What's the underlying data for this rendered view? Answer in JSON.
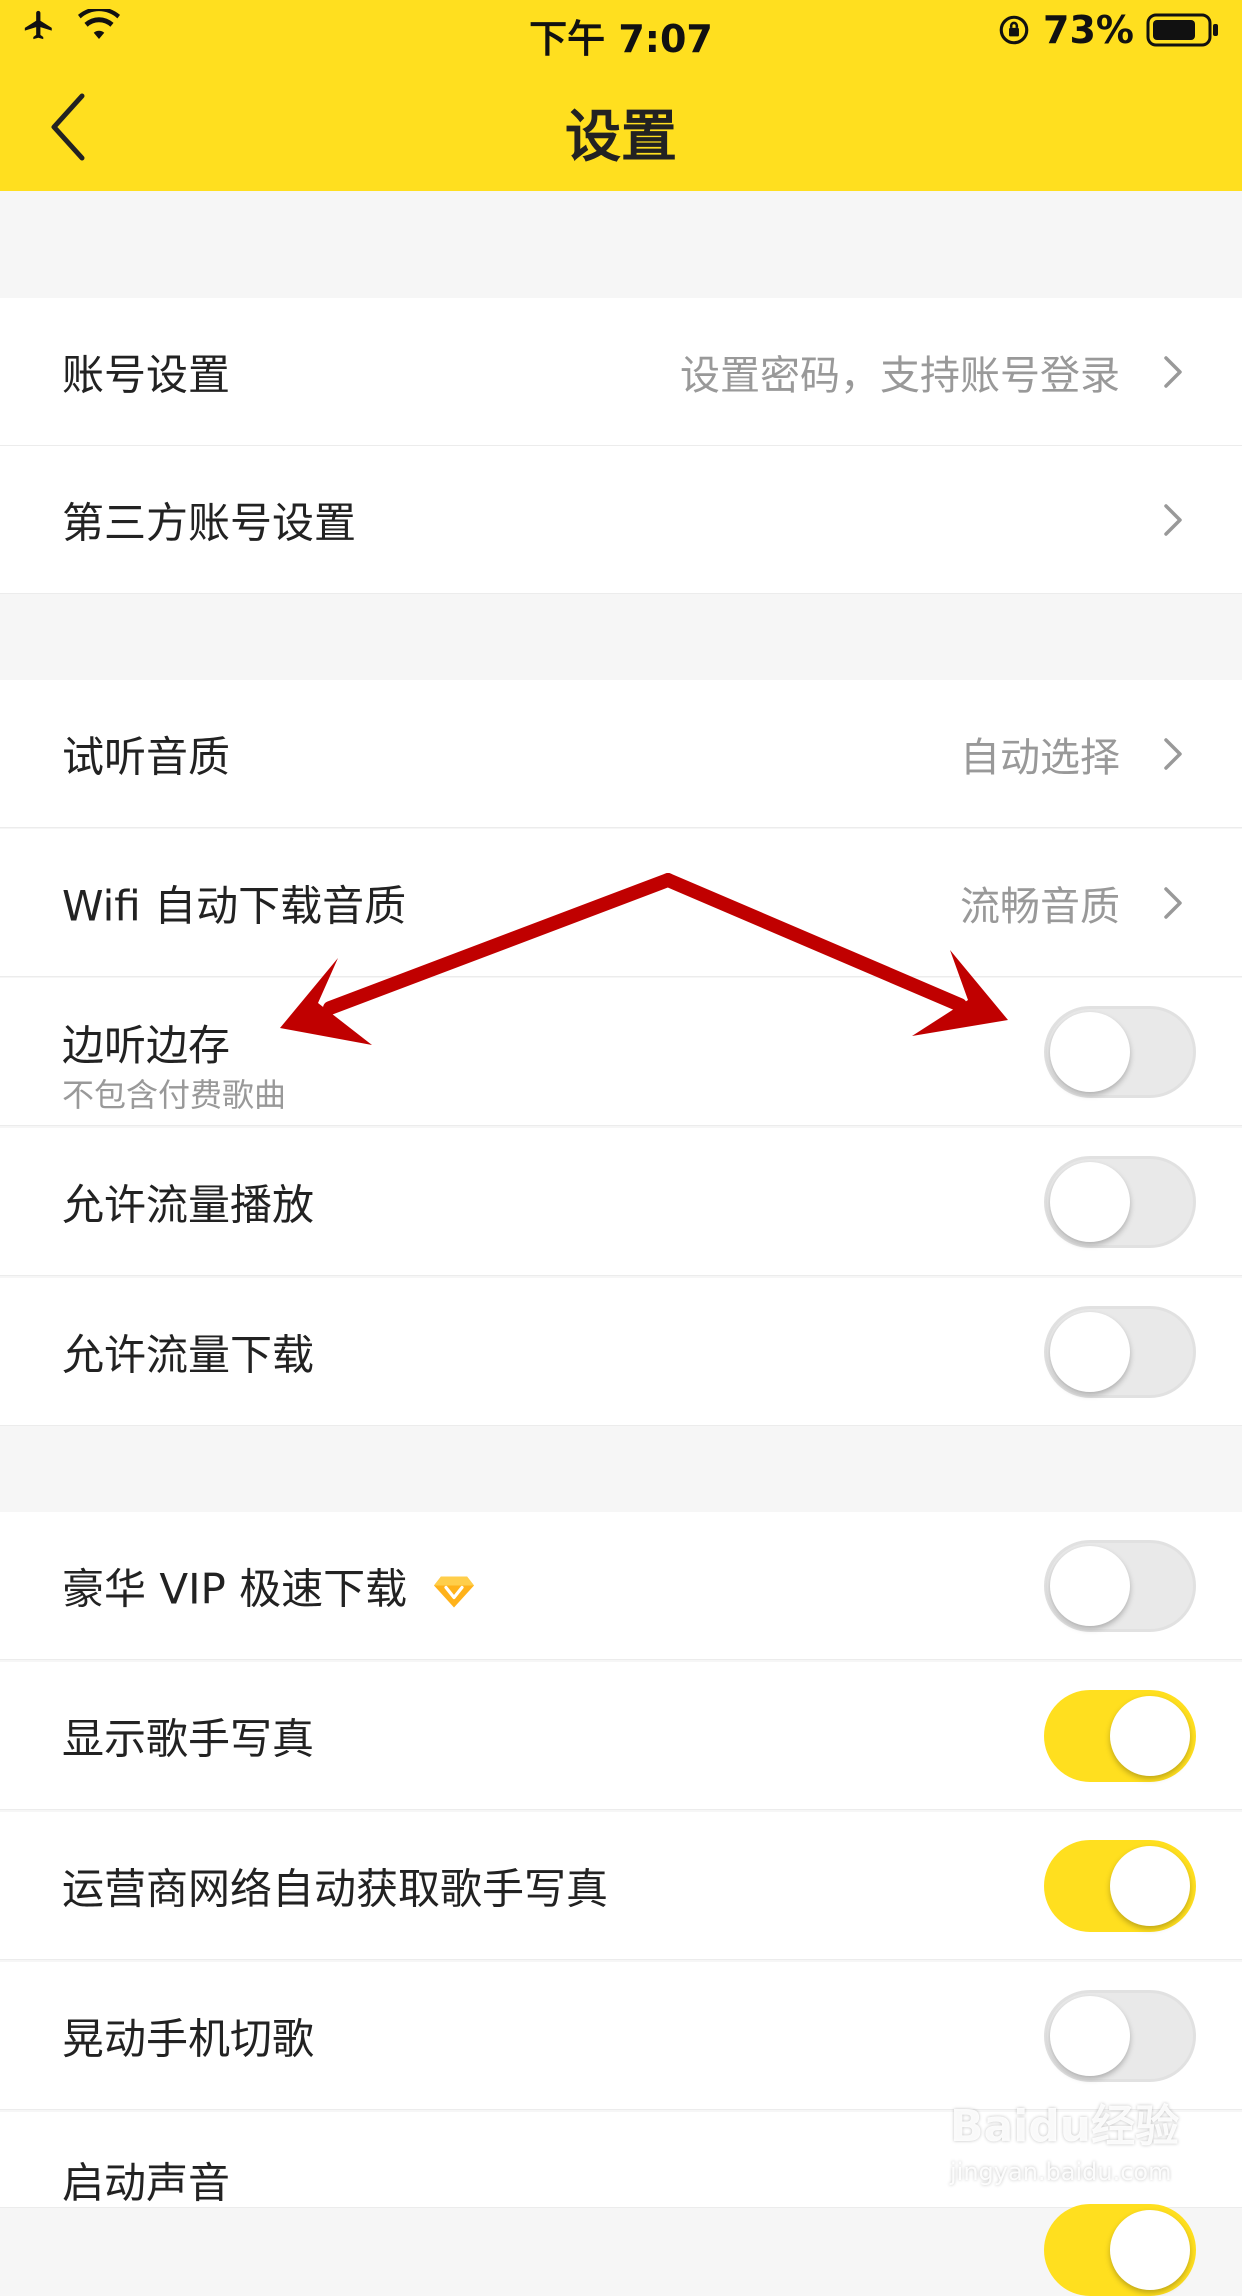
{
  "status_bar": {
    "time": "下午 7:07",
    "battery_percent": "73%"
  },
  "header": {
    "title": "设置"
  },
  "rows": [
    {
      "label": "账号设置",
      "value": "设置密码，支持账号登录"
    },
    {
      "label": "第三方账号设置"
    },
    {
      "label": "试听音质",
      "value": "自动选择"
    },
    {
      "label": "Wifi 自动下载音质",
      "value": "流畅音质"
    },
    {
      "label": "边听边存",
      "sub": "不包含付费歌曲",
      "on": false
    },
    {
      "label": "允许流量播放",
      "on": false
    },
    {
      "label": "允许流量下载",
      "on": false
    },
    {
      "label": "豪华 VIP 极速下载",
      "on": false
    },
    {
      "label": "显示歌手写真",
      "on": true
    },
    {
      "label": "运营商网络自动获取歌手写真",
      "on": true
    },
    {
      "label": "晃动手机切歌",
      "on": false
    },
    {
      "label": "启动声音",
      "on": true
    }
  ],
  "colors": {
    "accent": "#ffdf1f",
    "arrow": "#c00000"
  },
  "watermark": {
    "brand": "Baidu经验",
    "url": "jingyan.baidu.com"
  }
}
